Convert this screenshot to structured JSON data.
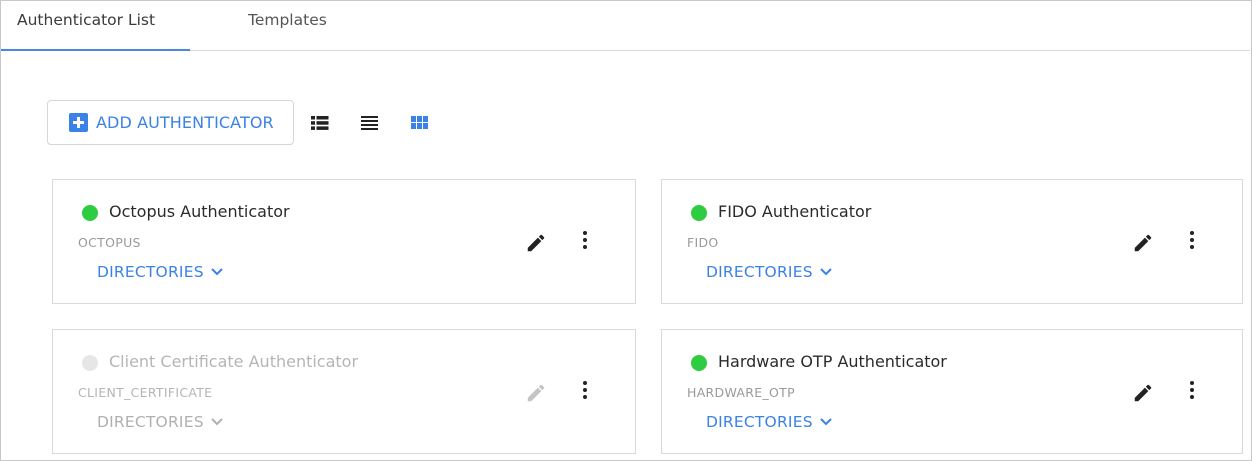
{
  "tabs": [
    {
      "label": "Authenticator List",
      "active": true
    },
    {
      "label": "Templates",
      "active": false
    }
  ],
  "toolbar": {
    "add_label": "ADD AUTHENTICATOR",
    "views": [
      "list-detail-view-icon",
      "list-view-icon",
      "grid-view-icon"
    ],
    "active_view": "grid"
  },
  "colors": {
    "accent": "#3b82e6",
    "status_enabled": "#2ecc40",
    "status_disabled": "#e6e6e6"
  },
  "cards": [
    {
      "title": "Octopus Authenticator",
      "subtitle": "OCTOPUS",
      "directories_label": "DIRECTORIES",
      "enabled": true
    },
    {
      "title": "FIDO Authenticator",
      "subtitle": "FIDO",
      "directories_label": "DIRECTORIES",
      "enabled": true
    },
    {
      "title": "Client Certificate Authenticator",
      "subtitle": "CLIENT_CERTIFICATE",
      "directories_label": "DIRECTORIES",
      "enabled": false
    },
    {
      "title": "Hardware OTP Authenticator",
      "subtitle": "HARDWARE_OTP",
      "directories_label": "DIRECTORIES",
      "enabled": true
    }
  ]
}
